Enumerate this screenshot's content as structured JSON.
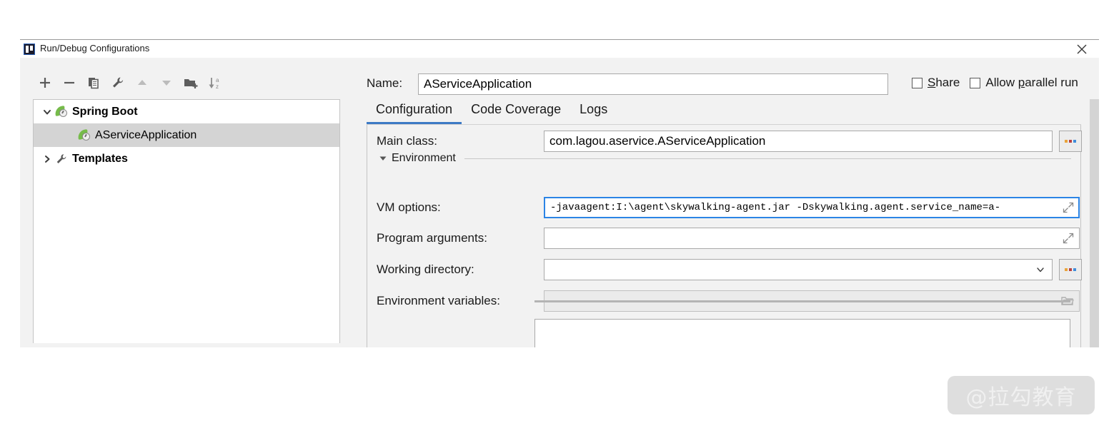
{
  "dialog": {
    "title": "Run/Debug Configurations",
    "close_label": "×"
  },
  "toolbar": {
    "buttons": [
      {
        "name": "add",
        "label": "+"
      },
      {
        "name": "remove",
        "label": "−"
      },
      {
        "name": "copy",
        "label": "Copy Configuration"
      },
      {
        "name": "edit-templates",
        "label": "Edit Templates"
      },
      {
        "name": "move-up",
        "label": "Move Up"
      },
      {
        "name": "move-down",
        "label": "Move Down"
      },
      {
        "name": "new-folder",
        "label": "Create New Folder"
      },
      {
        "name": "sort",
        "label": "Sort Configurations"
      }
    ]
  },
  "tree": {
    "items": [
      {
        "label": "Spring Boot",
        "type": "group",
        "expanded": true,
        "selected": false
      },
      {
        "label": "AServiceApplication",
        "type": "config",
        "expanded": false,
        "selected": true
      },
      {
        "label": "Templates",
        "type": "templates",
        "expanded": false,
        "selected": false
      }
    ]
  },
  "name_row": {
    "label": "Name:",
    "value": "AServiceApplication",
    "share": {
      "label_before": "",
      "accel": "S",
      "label_after": "hare",
      "checked": false
    },
    "parallel": {
      "label_before": "Allow ",
      "accel": "p",
      "label_after": "arallel run",
      "checked": false
    }
  },
  "tabs": [
    {
      "label": "Configuration",
      "active": true
    },
    {
      "label": "Code Coverage",
      "active": false
    },
    {
      "label": "Logs",
      "active": false
    }
  ],
  "form": {
    "main_class": {
      "label": "Main class:",
      "value": "com.lagou.aservice.AServiceApplication",
      "browse_label": "..."
    },
    "environment_section": {
      "label": "Environment",
      "expanded": true
    },
    "vm_options": {
      "label": "VM options:",
      "value": "-javaagent:I:\\agent\\skywalking-agent.jar -Dskywalking.agent.service_name=a-",
      "focused": true
    },
    "program_arguments": {
      "label": "Program arguments:",
      "value": ""
    },
    "working_directory": {
      "label": "Working directory:",
      "value": "",
      "browse_label": "..."
    },
    "environment_variables": {
      "label": "Environment variables:",
      "value": "",
      "disabled": true
    }
  },
  "watermark": {
    "text": "@拉勾教育"
  },
  "colors": {
    "accent": "#3d7ac5",
    "focus_border": "#2b84e5",
    "selection": "#d4d4d4",
    "dialog_bg": "#f2f2f2",
    "spring_green": "#76bb4a"
  }
}
